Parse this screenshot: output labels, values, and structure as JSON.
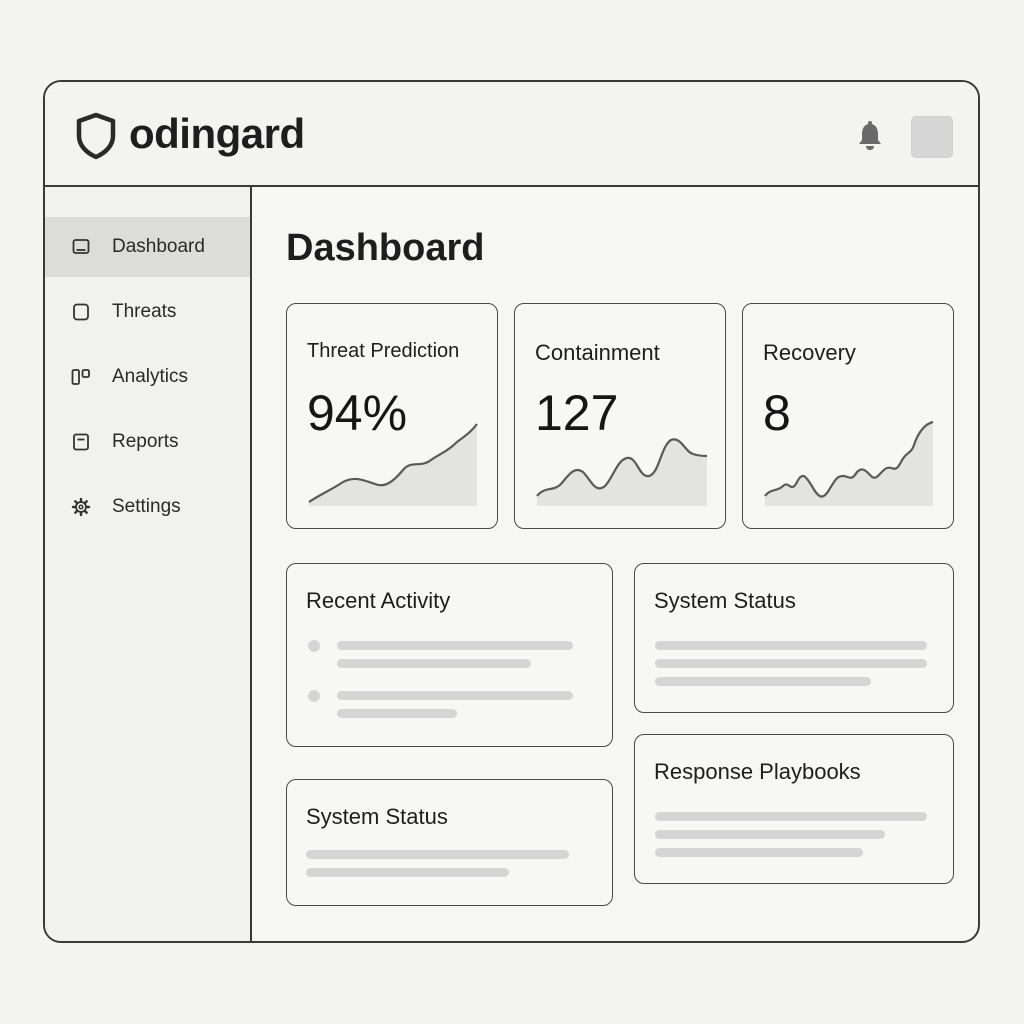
{
  "app": {
    "title": "odingard"
  },
  "icons": {
    "logo": "shield-icon",
    "notifications": "bell-icon",
    "dashboard": "monitor-icon",
    "threats": "square-icon",
    "analytics": "columns-icon",
    "reports": "document-icon",
    "settings": "gear-icon"
  },
  "sidebar": {
    "items": [
      {
        "label": "Dashboard",
        "active": true
      },
      {
        "label": "Threats",
        "active": false
      },
      {
        "label": "Analytics",
        "active": false
      },
      {
        "label": "Reports",
        "active": false
      },
      {
        "label": "Settings",
        "active": false
      }
    ]
  },
  "main": {
    "title": "Dashboard",
    "stats": [
      {
        "title": "Threat Prediction",
        "value": "94%"
      },
      {
        "title": "Containment",
        "value": "127"
      },
      {
        "title": "Recovery",
        "value": "8"
      }
    ],
    "panels": {
      "recent_activity": {
        "title": "Recent Activity"
      },
      "system_status_top": {
        "title": "System Status"
      },
      "system_status_bottom": {
        "title": "System Status"
      },
      "response_playbooks": {
        "title": "Response Playbooks"
      }
    }
  },
  "colors": {
    "border": "#3a3a3a",
    "active_nav": "#dcdcdb",
    "placeholder_bar": "#d5d5d5",
    "sparkline_fill": "#e3e3e2",
    "sparkline_line": "#5a5a5a"
  }
}
